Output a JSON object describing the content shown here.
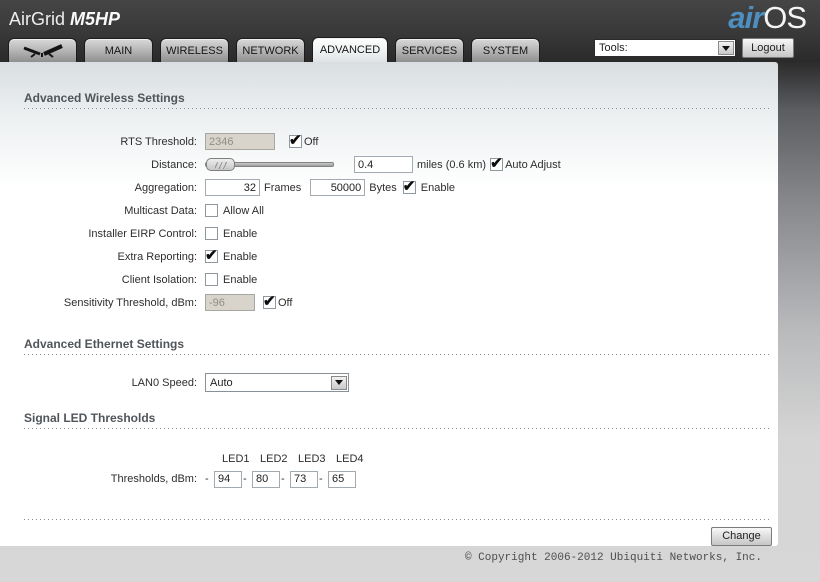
{
  "header": {
    "device_name": "AirGrid ",
    "device_model": "M5HP",
    "brand_air": "air",
    "brand_os": "OS"
  },
  "colors": {
    "brand_air_blue": "#4d8fc0",
    "header_dark": "#383838",
    "accent_check": "#0d0d0d"
  },
  "tabs": [
    "MAIN",
    "WIRELESS",
    "NETWORK",
    "ADVANCED",
    "SERVICES",
    "SYSTEM"
  ],
  "active_tab": "ADVANCED",
  "toolbar": {
    "tools_label": "Tools:",
    "logout_label": "Logout"
  },
  "wireless": {
    "title": "Advanced Wireless Settings",
    "rts": {
      "label": "RTS Threshold:",
      "value": "2346",
      "off_label": "Off",
      "off_checked": true
    },
    "distance": {
      "label": "Distance:",
      "value": "0.4",
      "unit": "miles (0.6 km)",
      "auto_label": "Auto Adjust",
      "auto_checked": true
    },
    "aggregation": {
      "label": "Aggregation:",
      "frames_value": "32",
      "frames_label": "Frames",
      "bytes_value": "50000",
      "bytes_label": "Bytes",
      "enable_label": "Enable",
      "enable_checked": true
    },
    "multicast": {
      "label": "Multicast Data:",
      "checkbox_label": "Allow All",
      "checked": false
    },
    "eirp": {
      "label": "Installer EIRP Control:",
      "checkbox_label": "Enable",
      "checked": false
    },
    "extra_reporting": {
      "label": "Extra Reporting:",
      "checkbox_label": "Enable",
      "checked": true
    },
    "client_isolation": {
      "label": "Client Isolation:",
      "checkbox_label": "Enable",
      "checked": false
    },
    "sensitivity": {
      "label": "Sensitivity Threshold, dBm:",
      "value": "-96",
      "off_label": "Off",
      "off_checked": true
    }
  },
  "ethernet": {
    "title": "Advanced Ethernet Settings",
    "lan0": {
      "label": "LAN0 Speed:",
      "value": "Auto"
    }
  },
  "led": {
    "title": "Signal LED Thresholds",
    "label": "Thresholds, dBm:",
    "separator": "-",
    "columns": [
      "LED1",
      "LED2",
      "LED3",
      "LED4"
    ],
    "values": [
      "94",
      "80",
      "73",
      "65"
    ]
  },
  "footer": {
    "change_label": "Change",
    "copyright": "© Copyright 2006-2012 Ubiquiti Networks, Inc."
  }
}
